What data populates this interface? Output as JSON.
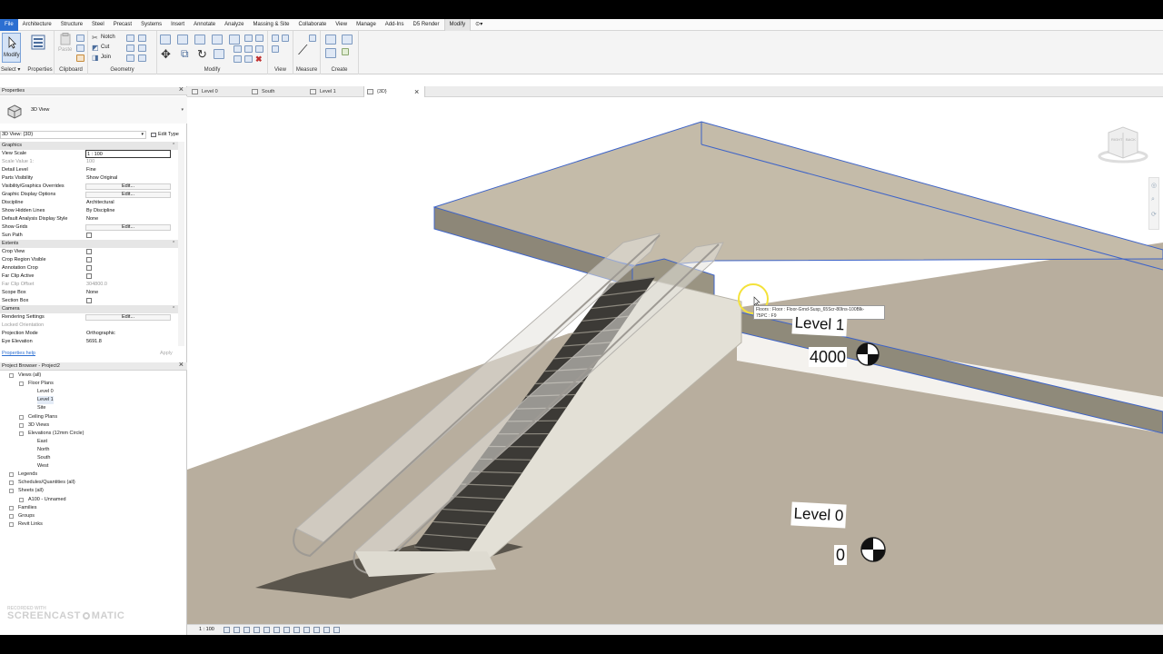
{
  "menu": {
    "tabs": [
      "File",
      "Architecture",
      "Structure",
      "Steel",
      "Precast",
      "Systems",
      "Insert",
      "Annotate",
      "Analyze",
      "Massing & Site",
      "Collaborate",
      "View",
      "Manage",
      "Add-Ins",
      "D5 Render",
      "Modify"
    ],
    "extra": "⊙▾"
  },
  "ribbon": {
    "modify_label": "Modify",
    "paste_label": "Paste",
    "notch_label": "Notch",
    "cut_label": "Cut",
    "join_label": "Join",
    "panels": [
      "Select ▾",
      "Properties",
      "Clipboard",
      "Geometry",
      "Modify",
      "View",
      "Measure",
      "Create"
    ]
  },
  "view_tabs": [
    {
      "label": "Level 0"
    },
    {
      "label": "South"
    },
    {
      "label": "Level 1"
    },
    {
      "label": "{3D}"
    }
  ],
  "properties": {
    "title": "Properties",
    "type_name": "3D View",
    "selector_value": "3D View: {3D}",
    "edit_type_label": "Edit Type",
    "rows": [
      {
        "kind": "sec",
        "label": "Graphics"
      },
      {
        "kind": "box",
        "label": "View Scale",
        "value": "1 : 100"
      },
      {
        "kind": "gray",
        "label": "Scale Value    1:",
        "value": "100"
      },
      {
        "kind": "text",
        "label": "Detail Level",
        "value": "Fine"
      },
      {
        "kind": "text",
        "label": "Parts Visibility",
        "value": "Show Original"
      },
      {
        "kind": "btn",
        "label": "Visibility/Graphics Overrides",
        "value": "Edit..."
      },
      {
        "kind": "btn",
        "label": "Graphic Display Options",
        "value": "Edit..."
      },
      {
        "kind": "text",
        "label": "Discipline",
        "value": "Architectural"
      },
      {
        "kind": "text",
        "label": "Show Hidden Lines",
        "value": "By Discipline"
      },
      {
        "kind": "text",
        "label": "Default Analysis Display Style",
        "value": "None"
      },
      {
        "kind": "btn",
        "label": "Show Grids",
        "value": "Edit..."
      },
      {
        "kind": "cb",
        "label": "Sun Path",
        "value": ""
      },
      {
        "kind": "sec",
        "label": "Extents"
      },
      {
        "kind": "cb",
        "label": "Crop View",
        "value": ""
      },
      {
        "kind": "cb",
        "label": "Crop Region Visible",
        "value": ""
      },
      {
        "kind": "cb",
        "label": "Annotation Crop",
        "value": ""
      },
      {
        "kind": "cb",
        "label": "Far Clip Active",
        "value": ""
      },
      {
        "kind": "gray",
        "label": "Far Clip Offset",
        "value": "304800.0"
      },
      {
        "kind": "text",
        "label": "Scope Box",
        "value": "None"
      },
      {
        "kind": "cb",
        "label": "Section Box",
        "value": ""
      },
      {
        "kind": "sec",
        "label": "Camera"
      },
      {
        "kind": "btn",
        "label": "Rendering Settings",
        "value": "Edit..."
      },
      {
        "kind": "gray",
        "label": "Locked Orientation",
        "value": ""
      },
      {
        "kind": "text",
        "label": "Projection Mode",
        "value": "Orthographic"
      },
      {
        "kind": "text",
        "label": "Eye Elevation",
        "value": "5691.8"
      }
    ],
    "help_link": "Properties help",
    "apply_label": "Apply"
  },
  "browser": {
    "title": "Project Browser - Project2",
    "items": [
      {
        "label": "Views (all)",
        "level": 0,
        "sel": false
      },
      {
        "label": "Floor Plans",
        "level": 1,
        "sel": false
      },
      {
        "label": "Level 0",
        "level": 2,
        "sel": false
      },
      {
        "label": "Level 1",
        "level": 2,
        "sel": true
      },
      {
        "label": "Site",
        "level": 2,
        "sel": false
      },
      {
        "label": "Ceiling Plans",
        "level": 1,
        "sel": false
      },
      {
        "label": "3D Views",
        "level": 1,
        "sel": false
      },
      {
        "label": "Elevations (12mm Circle)",
        "level": 1,
        "sel": false
      },
      {
        "label": "East",
        "level": 2,
        "sel": false
      },
      {
        "label": "North",
        "level": 2,
        "sel": false
      },
      {
        "label": "South",
        "level": 2,
        "sel": false
      },
      {
        "label": "West",
        "level": 2,
        "sel": false
      },
      {
        "label": "Legends",
        "level": 0,
        "sel": false
      },
      {
        "label": "Schedules/Quantities (all)",
        "level": 0,
        "sel": false
      },
      {
        "label": "Sheets (all)",
        "level": 0,
        "sel": false
      },
      {
        "label": "A100 - Unnamed",
        "level": 1,
        "sel": false
      },
      {
        "label": "Families",
        "level": 0,
        "sel": false
      },
      {
        "label": "Groups",
        "level": 0,
        "sel": false
      },
      {
        "label": "Revit Links",
        "level": 0,
        "sel": false
      }
    ]
  },
  "viewport": {
    "level1_name": "Level 1",
    "level1_elev": "4000",
    "level0_name": "Level 0",
    "level0_elev": "0",
    "tooltip_line1": "Floors : Floor : Floor-Grnd-Susp_65Scr-80Ins-100Blk-",
    "tooltip_line2": "75PC : F9",
    "viewcube_left": "RIGHT",
    "viewcube_right": "BACK"
  },
  "statusbar": {
    "scale": "1 : 100"
  },
  "watermark": {
    "line1": "RECORDED WITH",
    "line2": "SCREENCAST",
    "line3": "MATIC"
  },
  "colors": {
    "ground": "#b8ae9e",
    "slab_top": "#c1b8a8",
    "slab_side": "#908a78",
    "selection": "#3d63c8",
    "accent": "#2c6fd1"
  }
}
